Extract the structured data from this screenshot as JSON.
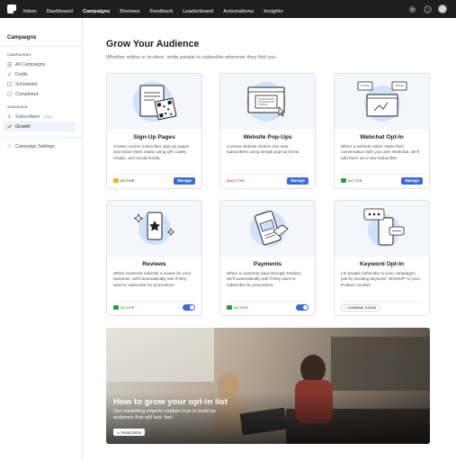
{
  "topnav": {
    "items": [
      "Inbox",
      "Dashboard",
      "Campaigns",
      "Reviews",
      "Feedback",
      "Leaderboard",
      "Automations",
      "Insights"
    ],
    "active": "Campaigns"
  },
  "sidebar": {
    "title": "Campaigns",
    "section_campaigns": "CAMPAIGNS",
    "campaign_items": [
      {
        "label": "All Campaigns",
        "icon": "list-icon"
      },
      {
        "label": "Drafts",
        "icon": "pencil-icon"
      },
      {
        "label": "Scheduled",
        "icon": "calendar-icon"
      },
      {
        "label": "Completed",
        "icon": "check-circle-icon"
      }
    ],
    "section_audience": "AUDIENCE",
    "audience_items": [
      {
        "label": "Subscribers",
        "icon": "people-icon",
        "badge": "(474)"
      },
      {
        "label": "Growth",
        "icon": "trend-up-icon",
        "selected": true
      }
    ],
    "settings_label": "Campaign Settings"
  },
  "main": {
    "title": "Grow Your Audience",
    "subtitle": "Whether online or in-store, invite people to subscribe wherever they find you."
  },
  "cards": [
    {
      "title": "Sign-Up Pages",
      "desc": "Create custom subscriber sign-up pages and share them easily using QR codes, emails, and social media.",
      "status": "ACTIVE",
      "status_color": "#f2b705",
      "action": "Manage",
      "action_type": "button",
      "icon": "qr-page-icon"
    },
    {
      "title": "Website Pop-Ups",
      "desc": "Convert website visitors into new subscribers using simple pop-up forms.",
      "status": "INACTIVE",
      "status_color": "#d0454c",
      "action": "Manage",
      "action_type": "button",
      "icon": "browser-popup-icon"
    },
    {
      "title": "Webchat Opt-In",
      "desc": "When a website visitor starts their conversation with you over Webchat, we'll add them as a new subscriber.",
      "status": "ACTIVE",
      "status_color": "#2e9d4f",
      "action": "Manage",
      "action_type": "button",
      "icon": "chat-window-icon"
    },
    {
      "title": "Reviews",
      "desc": "When someone submits a review for your business, we'll automatically ask if they want to subscribe for promotions.",
      "status": "ACTIVE",
      "status_color": "#2e9d4f",
      "action": "",
      "action_type": "toggle",
      "icon": "phone-review-icon"
    },
    {
      "title": "Payments",
      "desc": "When a customer pays through Podium, we'll automatically ask if they want to subscribe for promotions.",
      "status": "ACTIVE",
      "status_color": "#2e9d4f",
      "action": "",
      "action_type": "toggle",
      "icon": "payment-phone-icon"
    },
    {
      "title": "Keyword Opt-In",
      "desc": "Let people subscribe to your campaigns just by sending keyword \"SIGNUP\" to your Podium number.",
      "status": "COMING SOON",
      "status_color": "",
      "action": "",
      "action_type": "none",
      "icon": "phone-message-icon"
    }
  ],
  "hero": {
    "title": "How to grow your opt-in list",
    "desc": "Our marketing experts explain how to build an audience that will last, fast.",
    "button": "Read article"
  },
  "colors": {
    "accent": "#3a6bd8",
    "topbar": "#1e1e1e",
    "art_bg": "#f4f6fb",
    "illustration_blue": "#cfe2fb"
  }
}
